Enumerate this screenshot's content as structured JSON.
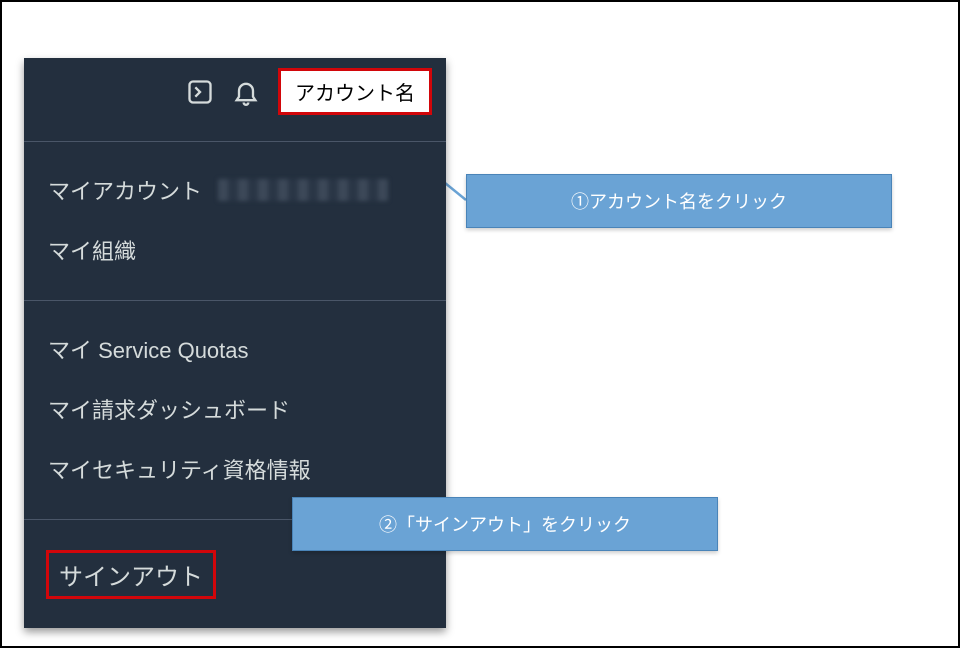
{
  "topbar": {
    "account_name_label": "アカウント名"
  },
  "menu": {
    "section1": {
      "my_account": "マイアカウント",
      "my_org": "マイ組織"
    },
    "section2": {
      "my_service_quotas": "マイ Service Quotas",
      "my_billing": "マイ請求ダッシュボード",
      "my_security": "マイセキュリティ資格情報"
    },
    "signout": "サインアウト"
  },
  "callouts": {
    "step1": "①アカウント名をクリック",
    "step2": "②「サインアウト」をクリック"
  },
  "colors": {
    "panel_bg": "#232f3e",
    "highlight_red": "#d2060a",
    "callout_blue": "#6aa3d5"
  }
}
